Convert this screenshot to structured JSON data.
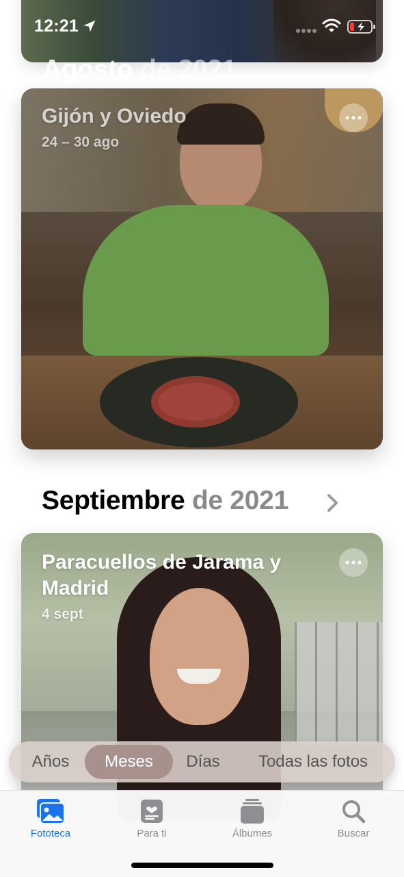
{
  "status_bar": {
    "time": "12:21"
  },
  "sections": {
    "august": {
      "month": "Agosto",
      "year": "de 2021",
      "card": {
        "title": "Gijón y Oviedo",
        "subtitle": "24 – 30 ago"
      }
    },
    "september": {
      "month": "Septiembre",
      "year": "de 2021",
      "card": {
        "title": "Paracuellos de Jarama y Madrid",
        "subtitle": "4 sept"
      }
    }
  },
  "segments": {
    "items": [
      {
        "label": "Años"
      },
      {
        "label": "Meses",
        "selected": true
      },
      {
        "label": "Días"
      },
      {
        "label": "Todas las fotos"
      }
    ]
  },
  "tab_bar": {
    "items": [
      {
        "label": "Fototeca",
        "icon": "photo-library-icon",
        "active": true
      },
      {
        "label": "Para ti",
        "icon": "for-you-icon"
      },
      {
        "label": "Álbumes",
        "icon": "albums-icon"
      },
      {
        "label": "Buscar",
        "icon": "search-icon"
      }
    ]
  },
  "colors": {
    "accent": "#1a73e8",
    "segment_selected": "#a8918c",
    "inactive_tab": "#8e8e93"
  }
}
